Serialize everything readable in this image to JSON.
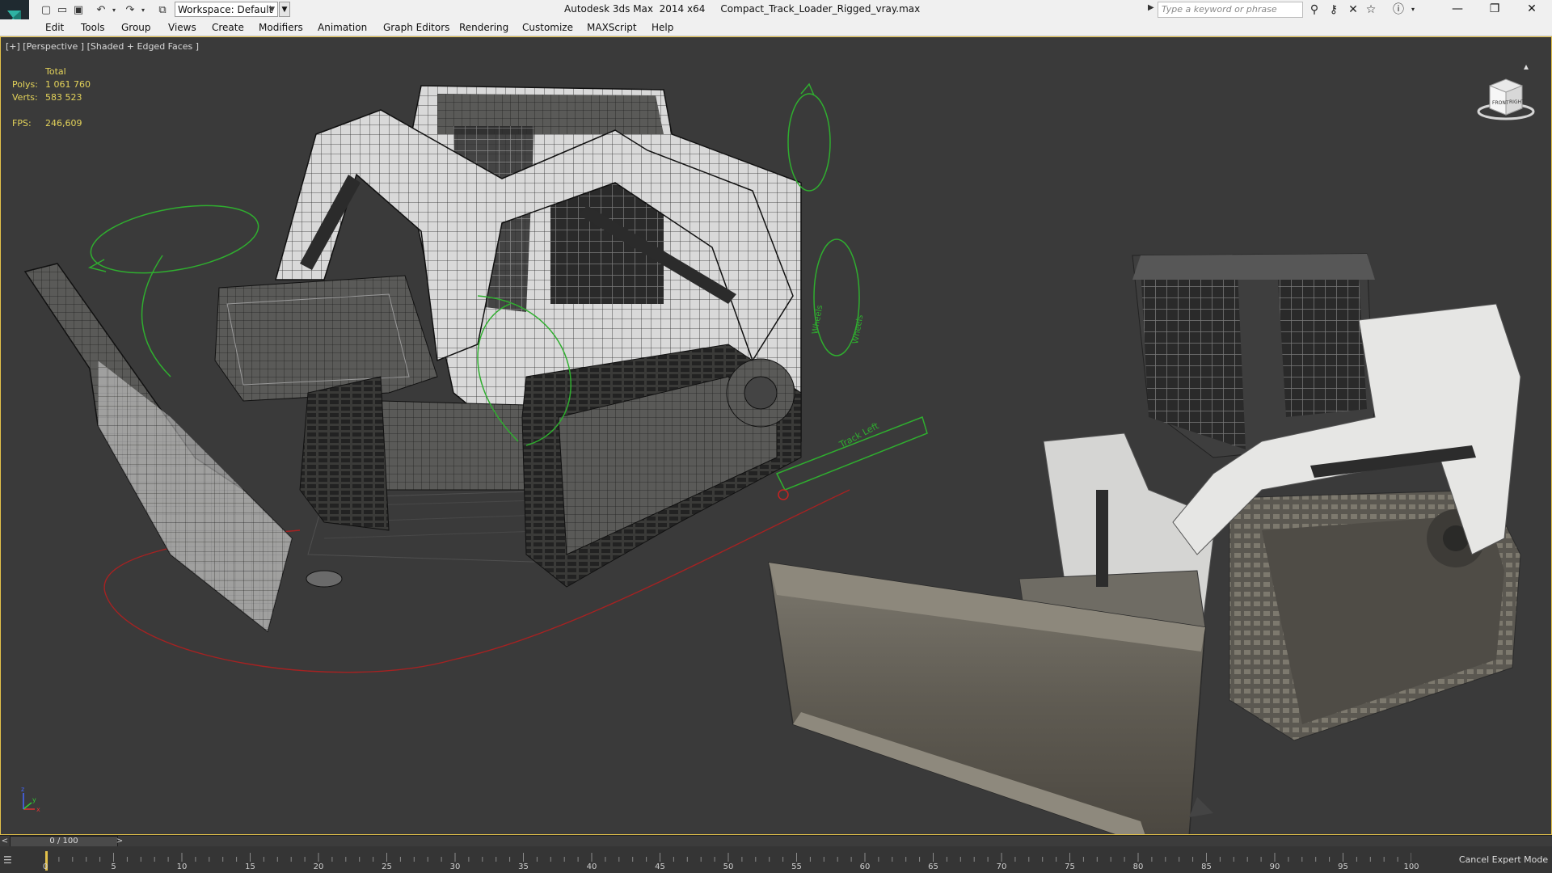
{
  "titlebar": {
    "workspace_label": "Workspace: Default",
    "app_title": "Autodesk 3ds Max  2014 x64     Compact_Track_Loader_Rigged_vray.max",
    "search_placeholder": "Type a keyword or phrase"
  },
  "menu": [
    {
      "label": "Edit"
    },
    {
      "label": "Tools"
    },
    {
      "label": "Group"
    },
    {
      "label": "Views"
    },
    {
      "label": "Create"
    },
    {
      "label": "Modifiers"
    },
    {
      "label": "Animation"
    },
    {
      "label": "Graph Editors"
    },
    {
      "label": "Rendering"
    },
    {
      "label": "Customize"
    },
    {
      "label": "MAXScript"
    },
    {
      "label": "Help"
    }
  ],
  "viewport": {
    "label": "[+] [Perspective ] [Shaded + Edged Faces ]",
    "stats": {
      "header": "Total",
      "polys_label": "Polys:",
      "polys_value": "1 061 760",
      "verts_label": "Verts:",
      "verts_value": "583 523",
      "fps_label": "FPS:",
      "fps_value": "246,609"
    },
    "annotations": {
      "track_left": "Track Left",
      "wheels_label": "Wheels",
      "wheels_label_2": "Wheels"
    },
    "viewcube": {
      "front": "FRONT",
      "right": "RIGHT"
    },
    "axes": {
      "x": "x",
      "y": "y",
      "z": "z"
    }
  },
  "timeline": {
    "frame_display": "0 / 100",
    "prev": "<",
    "next": ">",
    "ticks": [
      "0",
      "5",
      "10",
      "15",
      "20",
      "25",
      "30",
      "35",
      "40",
      "45",
      "50",
      "55",
      "60",
      "65",
      "70",
      "75",
      "80",
      "85",
      "90",
      "95",
      "100"
    ],
    "cancel_expert": "Cancel Expert Mode"
  },
  "colors": {
    "viewport_bg": "#3a3a3a",
    "stats": "#e4d35a",
    "helper_green": "#2fae2f",
    "path_red": "#a52222",
    "active_border": "#e3c14a"
  }
}
